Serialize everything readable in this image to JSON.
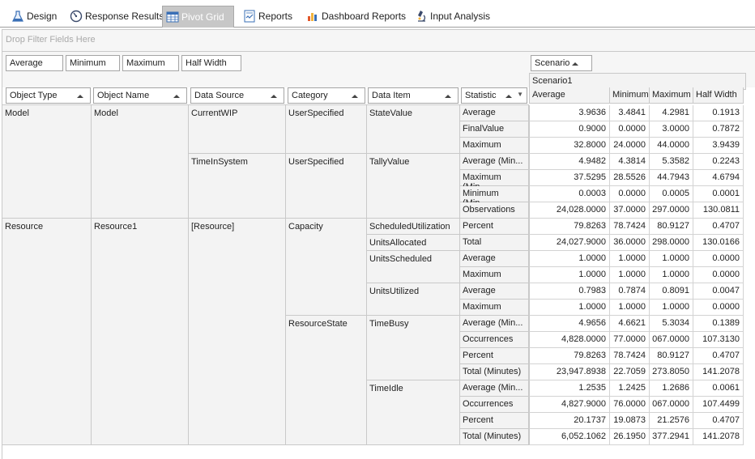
{
  "tabs": [
    {
      "label": "Design",
      "icon": "flask-icon",
      "active": false
    },
    {
      "label": "Response Results",
      "icon": "gauge-icon",
      "active": false
    },
    {
      "label": "Pivot Grid",
      "icon": "grid-icon",
      "active": true
    },
    {
      "label": "Reports",
      "icon": "report-icon",
      "active": false
    },
    {
      "label": "Dashboard Reports",
      "icon": "dashboard-icon",
      "active": false
    },
    {
      "label": "Input Analysis",
      "icon": "microscope-icon",
      "active": false
    }
  ],
  "filter_area": {
    "placeholder": "Drop Filter Fields Here"
  },
  "data_fields": [
    "Average",
    "Minimum",
    "Maximum",
    "Half Width"
  ],
  "column_field": "Scenario",
  "scenario_value": "Scenario1",
  "row_fields": [
    "Object Type",
    "Object Name",
    "Data Source",
    "Category",
    "Data Item",
    "Statistic"
  ],
  "value_headers": [
    "Average",
    "Minimum",
    "Maximum",
    "Half Width"
  ],
  "groups": {
    "object_type": [
      {
        "label": "Model",
        "start": 0,
        "span": 7
      },
      {
        "label": "Resource",
        "start": 7,
        "span": 14
      }
    ],
    "object_name": [
      {
        "label": "Model",
        "start": 0,
        "span": 7
      },
      {
        "label": "Resource1",
        "start": 7,
        "span": 14
      }
    ],
    "data_source": [
      {
        "label": "CurrentWIP",
        "start": 0,
        "span": 3
      },
      {
        "label": "TimeInSystem",
        "start": 3,
        "span": 4
      },
      {
        "label": "[Resource]",
        "start": 7,
        "span": 14
      }
    ],
    "category": [
      {
        "label": "UserSpecified",
        "start": 0,
        "span": 3
      },
      {
        "label": "UserSpecified",
        "start": 3,
        "span": 4
      },
      {
        "label": "Capacity",
        "start": 7,
        "span": 6
      },
      {
        "label": "ResourceState",
        "start": 13,
        "span": 8
      }
    ],
    "data_item": [
      {
        "label": "StateValue",
        "start": 0,
        "span": 3
      },
      {
        "label": "TallyValue",
        "start": 3,
        "span": 4
      },
      {
        "label": "ScheduledUtilization",
        "start": 7,
        "span": 1
      },
      {
        "label": "UnitsAllocated",
        "start": 8,
        "span": 1
      },
      {
        "label": "UnitsScheduled",
        "start": 9,
        "span": 2
      },
      {
        "label": "UnitsUtilized",
        "start": 11,
        "span": 2
      },
      {
        "label": "TimeBusy",
        "start": 13,
        "span": 4
      },
      {
        "label": "TimeIdle",
        "start": 17,
        "span": 4
      }
    ]
  },
  "rows": [
    {
      "statistic": "Average",
      "values": [
        "3.9636",
        "3.4841",
        "4.2981",
        "0.1913"
      ]
    },
    {
      "statistic": "FinalValue",
      "values": [
        "0.9000",
        "0.0000",
        "3.0000",
        "0.7872"
      ]
    },
    {
      "statistic": "Maximum",
      "values": [
        "32.8000",
        "24.0000",
        "44.0000",
        "3.9439"
      ]
    },
    {
      "statistic": "Average (Min...",
      "values": [
        "4.9482",
        "4.3814",
        "5.3582",
        "0.2243"
      ]
    },
    {
      "statistic": "Maximum (Min...",
      "values": [
        "37.5295",
        "28.5526",
        "44.7943",
        "4.6794"
      ]
    },
    {
      "statistic": "Minimum (Min...",
      "values": [
        "0.0003",
        "0.0000",
        "0.0005",
        "0.0001"
      ]
    },
    {
      "statistic": "Observations",
      "values": [
        "24,028.0000",
        "37.0000",
        "297.0000",
        "130.0811"
      ]
    },
    {
      "statistic": "Percent",
      "values": [
        "79.8263",
        "78.7424",
        "80.9127",
        "0.4707"
      ]
    },
    {
      "statistic": "Total",
      "values": [
        "24,027.9000",
        "36.0000",
        "298.0000",
        "130.0166"
      ]
    },
    {
      "statistic": "Average",
      "values": [
        "1.0000",
        "1.0000",
        "1.0000",
        "0.0000"
      ]
    },
    {
      "statistic": "Maximum",
      "values": [
        "1.0000",
        "1.0000",
        "1.0000",
        "0.0000"
      ]
    },
    {
      "statistic": "Average",
      "values": [
        "0.7983",
        "0.7874",
        "0.8091",
        "0.0047"
      ]
    },
    {
      "statistic": "Maximum",
      "values": [
        "1.0000",
        "1.0000",
        "1.0000",
        "0.0000"
      ]
    },
    {
      "statistic": "Average (Min...",
      "values": [
        "4.9656",
        "4.6621",
        "5.3034",
        "0.1389"
      ]
    },
    {
      "statistic": "Occurrences",
      "values": [
        "4,828.0000",
        "77.0000",
        "067.0000",
        "107.3130"
      ]
    },
    {
      "statistic": "Percent",
      "values": [
        "79.8263",
        "78.7424",
        "80.9127",
        "0.4707"
      ]
    },
    {
      "statistic": "Total (Minutes)",
      "values": [
        "23,947.8938",
        "22.7059",
        "273.8050",
        "141.2078"
      ]
    },
    {
      "statistic": "Average (Min...",
      "values": [
        "1.2535",
        "1.2425",
        "1.2686",
        "0.0061"
      ]
    },
    {
      "statistic": "Occurrences",
      "values": [
        "4,827.9000",
        "76.0000",
        "067.0000",
        "107.4499"
      ]
    },
    {
      "statistic": "Percent",
      "values": [
        "20.1737",
        "19.0873",
        "21.2576",
        "0.4707"
      ]
    },
    {
      "statistic": "Total (Minutes)",
      "values": [
        "6,052.1062",
        "26.1950",
        "377.2941",
        "141.2078"
      ]
    }
  ]
}
